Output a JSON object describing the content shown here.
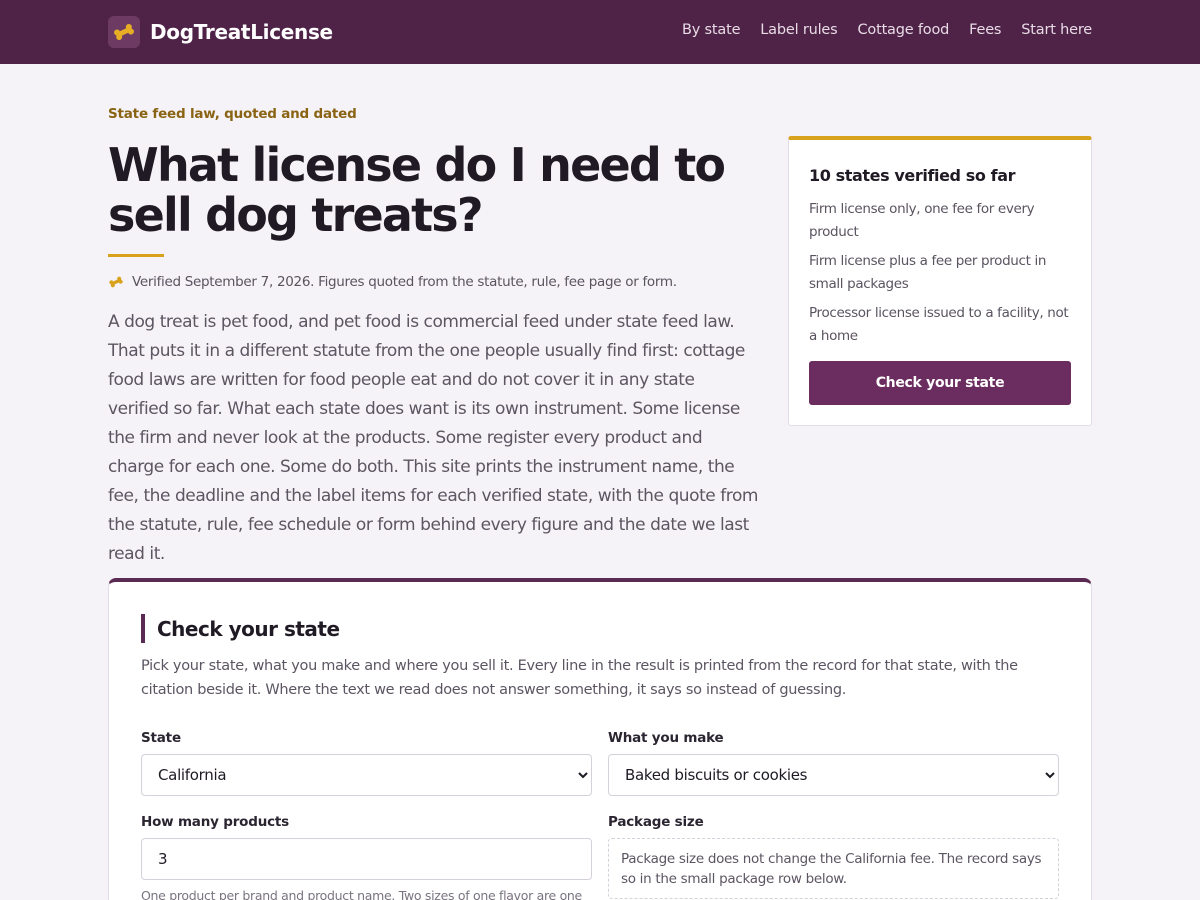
{
  "header": {
    "brand": "DogTreatLicense",
    "logo_icon": "bone-icon",
    "nav": [
      {
        "label": "By state"
      },
      {
        "label": "Label rules"
      },
      {
        "label": "Cottage food"
      },
      {
        "label": "Fees"
      },
      {
        "label": "Start here"
      }
    ]
  },
  "hero": {
    "eyebrow": "State feed law, quoted and dated",
    "title": "What license do I need to sell dog treats?",
    "verified": "Verified September 7, 2026. Figures quoted from the statute, rule, fee page or form.",
    "intro": "A dog treat is pet food, and pet food is commercial feed under state feed law. That puts it in a different statute from the one people usually find first: cottage food laws are written for food people eat and do not cover it in any state verified so far. What each state does want is its own instrument. Some license the firm and never look at the products. Some register every product and charge for each one. Some do both. This site prints the instrument name, the fee, the deadline and the label items for each verified state, with the quote from the statute, rule, fee schedule or form behind every figure and the date we last read it."
  },
  "sidebar": {
    "title": "10 states verified so far",
    "items": [
      "Firm license only, one fee for every product",
      "Firm license plus a fee per product in small packages",
      "Processor license issued to a facility, not a home"
    ],
    "cta": "Check your state"
  },
  "checker": {
    "title": "Check your state",
    "description": "Pick your state, what you make and where you sell it. Every line in the result is printed from the record for that state, with the citation beside it. Where the text we read does not answer something, it says so instead of guessing.",
    "state": {
      "label": "State",
      "value": "California"
    },
    "make": {
      "label": "What you make",
      "value": "Baked biscuits or cookies"
    },
    "products": {
      "label": "How many products",
      "value": "3",
      "hint": "One product per brand and product name. Two sizes of one flavor are one"
    },
    "package": {
      "label": "Package size",
      "note": "Package size does not change the California fee. The record says so in the small package row below."
    }
  },
  "colors": {
    "header_bg": "#4e2347",
    "accent_gold": "#d9a21d",
    "accent_plum": "#6b2d5f",
    "page_bg": "#f5f3f7"
  }
}
